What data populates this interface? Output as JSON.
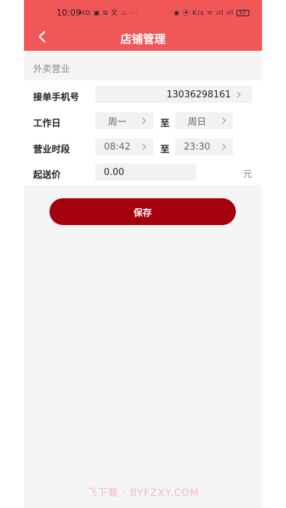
{
  "status_bar": {
    "time": "10:09",
    "left_icons": "HD ▣ ⧉ 文 ♨ ···",
    "right_icons": "◉ ⦿ K/s ᯤ ıll ıll",
    "battery": "80"
  },
  "header": {
    "title": "店铺管理"
  },
  "section": {
    "label": "外卖营业"
  },
  "form": {
    "phone": {
      "label": "接单手机号",
      "value": "13036298161"
    },
    "workday": {
      "label": "工作日",
      "from": "周一",
      "to_label": "至",
      "to": "周日"
    },
    "hours": {
      "label": "营业时段",
      "from": "08:42",
      "to_label": "至",
      "to": "23:30"
    },
    "min_price": {
      "label": "起送价",
      "value": "0.00",
      "unit": "元"
    }
  },
  "actions": {
    "save_label": "保存"
  },
  "watermark": "飞下载 · BYFZXY.COM",
  "colors": {
    "header_bg": "#f25757",
    "save_button": "#a5000d"
  }
}
